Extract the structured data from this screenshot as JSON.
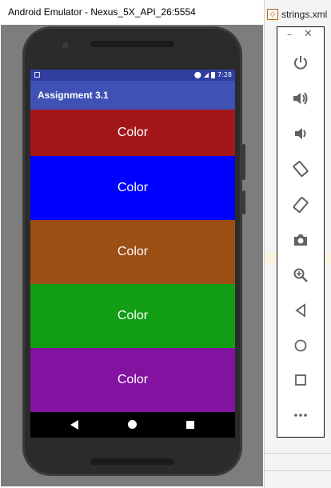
{
  "window": {
    "title": "Android Emulator - Nexus_5X_API_26:5554"
  },
  "ide": {
    "tab_label": "strings.xml",
    "tab_icon": "xml-file-icon"
  },
  "device": {
    "status_bar": {
      "time": "7:28",
      "icons": [
        "notification-icon",
        "location-icon",
        "signal-icon",
        "battery-icon"
      ]
    },
    "app_bar": {
      "title": "Assignment 3.1"
    },
    "color_rows": [
      {
        "label": "Color",
        "color": "#a31719"
      },
      {
        "label": "Color",
        "color": "#0000ff"
      },
      {
        "label": "Color",
        "color": "#9b4f14"
      },
      {
        "label": "Color",
        "color": "#119e15"
      },
      {
        "label": "Color",
        "color": "#8412a1"
      }
    ],
    "nav_bar": {
      "icons": [
        "back-icon",
        "home-icon",
        "recents-icon"
      ]
    }
  },
  "side_panel": {
    "window_controls": {
      "minimize": "–",
      "close": "✕"
    },
    "buttons": [
      "power",
      "volume-up",
      "volume-down",
      "rotate-left",
      "rotate-right",
      "screenshot",
      "zoom",
      "back",
      "home",
      "overview",
      "more"
    ]
  },
  "colors": {
    "status_bar": "#303f9f",
    "app_bar": "#3f51b5",
    "emulator_background": "#7d7d7d"
  }
}
